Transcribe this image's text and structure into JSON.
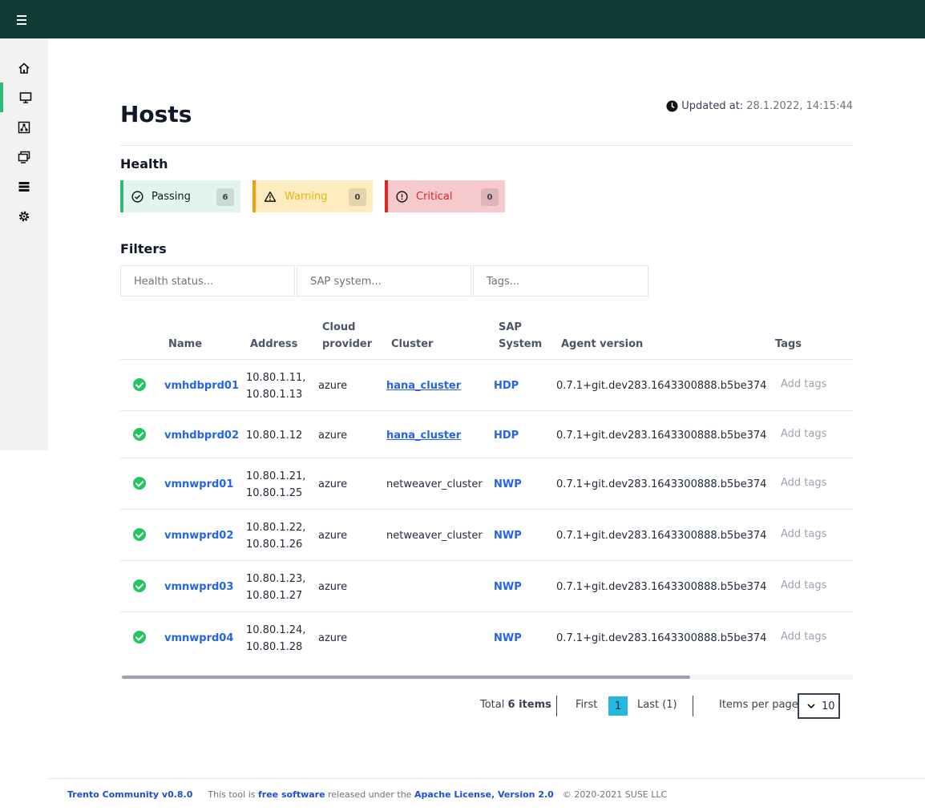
{
  "page": {
    "title": "Hosts"
  },
  "updated": {
    "label": "Updated at:",
    "value": "28.1.2022, 14:15:44"
  },
  "health": {
    "heading": "Health",
    "passing": {
      "label": "Passing",
      "count": "6"
    },
    "warning": {
      "label": "Warning",
      "count": "0"
    },
    "critical": {
      "label": "Critical",
      "count": "0"
    }
  },
  "filters": {
    "heading": "Filters",
    "health_placeholder": "Health status...",
    "sap_placeholder": "SAP system...",
    "tags_placeholder": "Tags..."
  },
  "table": {
    "headers": {
      "name": "Name",
      "address": "Address",
      "cloud1": "Cloud",
      "cloud2": "provider",
      "cluster": "Cluster",
      "sap1": "SAP",
      "sap2": "System",
      "agent": "Agent version",
      "tags": "Tags"
    },
    "rows": [
      {
        "name": "vmhdbprd01",
        "addr1": "10.80.1.11,",
        "addr2": "10.80.1.13",
        "cloud": "azure",
        "cluster": "hana_cluster",
        "sap": "HDP",
        "agent": "0.7.1+git.dev283.1643300888.b5be374",
        "tags": "Add tags"
      },
      {
        "name": "vmhdbprd02",
        "addr1": "10.80.1.12",
        "addr2": "",
        "cloud": "azure",
        "cluster": "hana_cluster",
        "sap": "HDP",
        "agent": "0.7.1+git.dev283.1643300888.b5be374",
        "tags": "Add tags"
      },
      {
        "name": "vmnwprd01",
        "addr1": "10.80.1.21,",
        "addr2": "10.80.1.25",
        "cloud": "azure",
        "cluster": "netweaver_cluster",
        "sap": "NWP",
        "agent": "0.7.1+git.dev283.1643300888.b5be374",
        "tags": "Add tags"
      },
      {
        "name": "vmnwprd02",
        "addr1": "10.80.1.22,",
        "addr2": "10.80.1.26",
        "cloud": "azure",
        "cluster": "netweaver_cluster",
        "sap": "NWP",
        "agent": "0.7.1+git.dev283.1643300888.b5be374",
        "tags": "Add tags"
      },
      {
        "name": "vmnwprd03",
        "addr1": "10.80.1.23,",
        "addr2": "10.80.1.27",
        "cloud": "azure",
        "cluster": "",
        "sap": "NWP",
        "agent": "0.7.1+git.dev283.1643300888.b5be374",
        "tags": "Add tags"
      },
      {
        "name": "vmnwprd04",
        "addr1": "10.80.1.24,",
        "addr2": "10.80.1.28",
        "cloud": "azure",
        "cluster": "",
        "sap": "NWP",
        "agent": "0.7.1+git.dev283.1643300888.b5be374",
        "tags": "Add tags"
      }
    ]
  },
  "pagination": {
    "total_prefix": "Total",
    "total_count": "6 items",
    "first": "First",
    "current": "1",
    "last": "Last (1)",
    "ipp_label": "Items per page",
    "ipp_value": "10"
  },
  "footer": {
    "product": "Trento Community v0.8.0",
    "text1": "This tool is",
    "free": "free software",
    "text2": "released under the",
    "license": "Apache License, Version 2.0",
    "copyright": "© 2020-2021 SUSE LLC"
  },
  "colors": {
    "topbar": "#0e3b34",
    "accent": "#30ba78",
    "link": "#2563eb"
  },
  "icons": {
    "sidebar": [
      "home-icon",
      "monitor-icon",
      "network-icon",
      "desktops-icon",
      "list-icon",
      "gear-icon"
    ]
  }
}
